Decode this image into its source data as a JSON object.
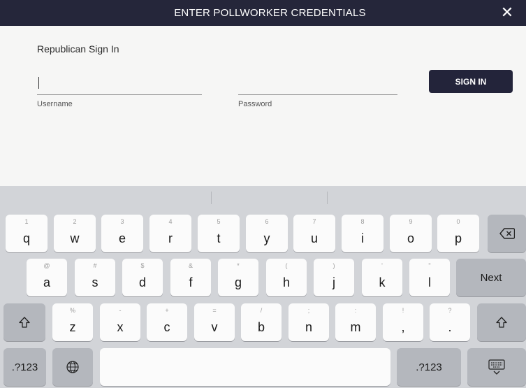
{
  "header": {
    "title": "ENTER POLLWORKER CREDENTIALS",
    "close_glyph": "✕"
  },
  "form": {
    "title": "Republican Sign In",
    "username_label": "Username",
    "password_label": "Password",
    "username_value": "",
    "password_value": "",
    "sign_in_label": "SIGN IN"
  },
  "keyboard": {
    "row1": [
      {
        "main": "q",
        "hint": "1"
      },
      {
        "main": "w",
        "hint": "2"
      },
      {
        "main": "e",
        "hint": "3"
      },
      {
        "main": "r",
        "hint": "4"
      },
      {
        "main": "t",
        "hint": "5"
      },
      {
        "main": "y",
        "hint": "6"
      },
      {
        "main": "u",
        "hint": "7"
      },
      {
        "main": "i",
        "hint": "8"
      },
      {
        "main": "o",
        "hint": "9"
      },
      {
        "main": "p",
        "hint": "0"
      }
    ],
    "row2": [
      {
        "main": "a",
        "hint": "@"
      },
      {
        "main": "s",
        "hint": "#"
      },
      {
        "main": "d",
        "hint": "$"
      },
      {
        "main": "f",
        "hint": "&"
      },
      {
        "main": "g",
        "hint": "*"
      },
      {
        "main": "h",
        "hint": "("
      },
      {
        "main": "j",
        "hint": ")"
      },
      {
        "main": "k",
        "hint": "'"
      },
      {
        "main": "l",
        "hint": "\""
      }
    ],
    "row3": [
      {
        "main": "z",
        "hint": "%"
      },
      {
        "main": "x",
        "hint": "-"
      },
      {
        "main": "c",
        "hint": "+"
      },
      {
        "main": "v",
        "hint": "="
      },
      {
        "main": "b",
        "hint": "/"
      },
      {
        "main": "n",
        "hint": ";"
      },
      {
        "main": "m",
        "hint": ":"
      },
      {
        "main": ",",
        "hint": "!"
      },
      {
        "main": ".",
        "hint": "?"
      }
    ],
    "next_label": "Next",
    "numbers_label_left": ".?123",
    "numbers_label_right": ".?123",
    "icons": {
      "backspace": "backspace-icon",
      "shift_left": "shift-icon",
      "shift_right": "shift-icon",
      "globe": "globe-icon",
      "dismiss": "keyboard-dismiss-icon"
    }
  }
}
